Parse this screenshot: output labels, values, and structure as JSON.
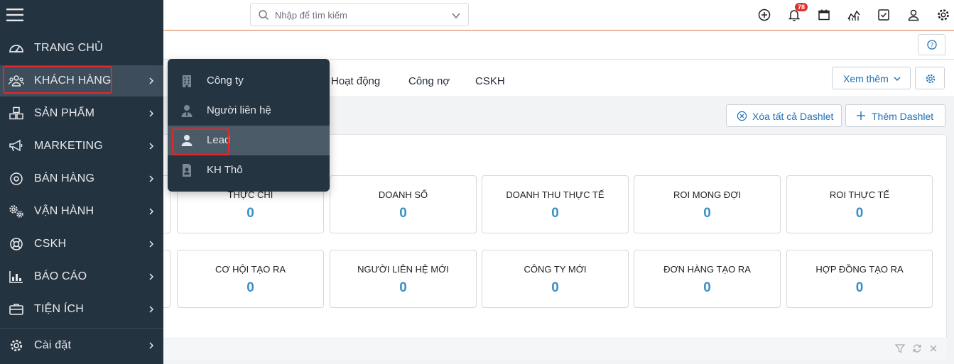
{
  "search": {
    "placeholder": "Nhập để tìm kiếm"
  },
  "notifications": {
    "count": "78"
  },
  "tabs": [
    {
      "label": "Hoạt động"
    },
    {
      "label": "Công nợ"
    },
    {
      "label": "CSKH"
    }
  ],
  "toolbar": {
    "more_label": "Xem thêm",
    "clear_dashlets_label": "Xóa tất cả Dashlet",
    "add_dashlet_label": "Thêm Dashlet"
  },
  "cards_row1": [
    {
      "title": "THỰC CHI",
      "value": "0"
    },
    {
      "title": "DOANH SỐ",
      "value": "0"
    },
    {
      "title": "DOANH THU THỰC TẾ",
      "value": "0"
    },
    {
      "title": "ROI MONG ĐỢI",
      "value": "0"
    },
    {
      "title": "ROI THỰC TẾ",
      "value": "0"
    }
  ],
  "cards_row2": [
    {
      "title": "CƠ HỘI TẠO RA",
      "value": "0"
    },
    {
      "title": "NGƯỜI LIÊN HỆ MỚI",
      "value": "0"
    },
    {
      "title": "CÔNG TY MỚI",
      "value": "0"
    },
    {
      "title": "ĐƠN HÀNG TẠO RA",
      "value": "0"
    },
    {
      "title": "HỢP ĐỒNG TẠO RA",
      "value": "0"
    }
  ],
  "sidebar": {
    "items": [
      {
        "label": "TRANG CHỦ",
        "icon": "dashboard-icon"
      },
      {
        "label": "KHÁCH HÀNG",
        "icon": "users-icon"
      },
      {
        "label": "SẢN PHẨM",
        "icon": "boxes-icon"
      },
      {
        "label": "MARKETING",
        "icon": "megaphone-icon"
      },
      {
        "label": "BÁN HÀNG",
        "icon": "target-icon"
      },
      {
        "label": "VẬN HÀNH",
        "icon": "gears-icon"
      },
      {
        "label": "CSKH",
        "icon": "lifebuoy-icon"
      },
      {
        "label": "BÁO CÁO",
        "icon": "bar-chart-icon"
      },
      {
        "label": "TIỆN ÍCH",
        "icon": "briefcase-icon"
      },
      {
        "label": "Cài đặt",
        "icon": "gear-icon"
      }
    ]
  },
  "submenu": {
    "items": [
      {
        "label": "Công ty",
        "icon": "building-icon"
      },
      {
        "label": "Người liên hệ",
        "icon": "contact-icon"
      },
      {
        "label": "Lead",
        "icon": "user-icon"
      },
      {
        "label": "KH Thô",
        "icon": "document-user-icon"
      }
    ]
  },
  "colors": {
    "sidebar_bg": "#243340",
    "accent_blue": "#1e6fb8",
    "value_blue": "#3a8fc6",
    "highlight_red": "#e0292b",
    "topbar_line": "#e8804c"
  }
}
